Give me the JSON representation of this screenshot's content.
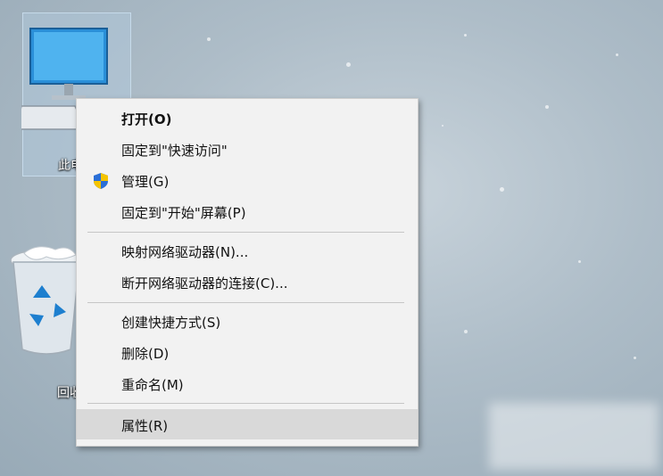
{
  "desktop": {
    "icons": [
      {
        "label": "此电脑"
      },
      {
        "label": "回收站"
      }
    ]
  },
  "context_menu": {
    "items": [
      {
        "label": "打开(O)"
      },
      {
        "label": "固定到\"快速访问\""
      },
      {
        "label": "管理(G)",
        "icon": "uac-shield-icon"
      },
      {
        "label": "固定到\"开始\"屏幕(P)"
      },
      {
        "label": "映射网络驱动器(N)..."
      },
      {
        "label": "断开网络驱动器的连接(C)..."
      },
      {
        "label": "创建快捷方式(S)"
      },
      {
        "label": "删除(D)"
      },
      {
        "label": "重命名(M)"
      },
      {
        "label": "属性(R)"
      }
    ]
  },
  "colors": {
    "menu_bg": "#f2f2f2",
    "hover_bg": "#d9d9d9",
    "shield_blue": "#2b6fd6",
    "shield_yellow": "#f5c400"
  }
}
